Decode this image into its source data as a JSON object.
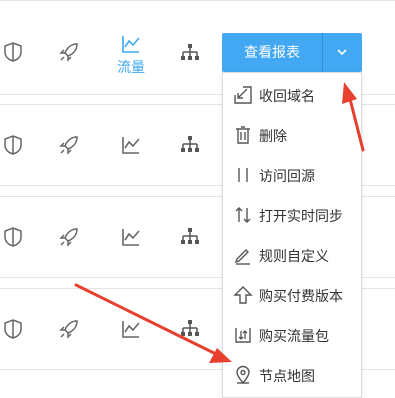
{
  "row_actions": {
    "traffic_label": "流量",
    "report_button_label": "查看报表"
  },
  "icons": [
    "shield-icon",
    "rocket-icon",
    "line-chart-icon",
    "node-tree-icon"
  ],
  "dropdown": {
    "items": [
      {
        "label": "收回域名",
        "icon": "reclaim-icon"
      },
      {
        "label": "删除",
        "icon": "trash-icon"
      },
      {
        "label": "访问回源",
        "icon": "origin-icon"
      },
      {
        "label": "打开实时同步",
        "icon": "sync-icon"
      },
      {
        "label": "规则自定义",
        "icon": "edit-icon"
      },
      {
        "label": "购买付费版本",
        "icon": "upgrade-icon"
      },
      {
        "label": "购买流量包",
        "icon": "package-icon"
      },
      {
        "label": "节点地图",
        "icon": "location-pin-icon"
      }
    ]
  },
  "colors": {
    "accent": "#42a8f3",
    "active_icon": "#3ea9f5",
    "annotation_arrow": "#e8402f",
    "icon_gray": "#666666"
  }
}
